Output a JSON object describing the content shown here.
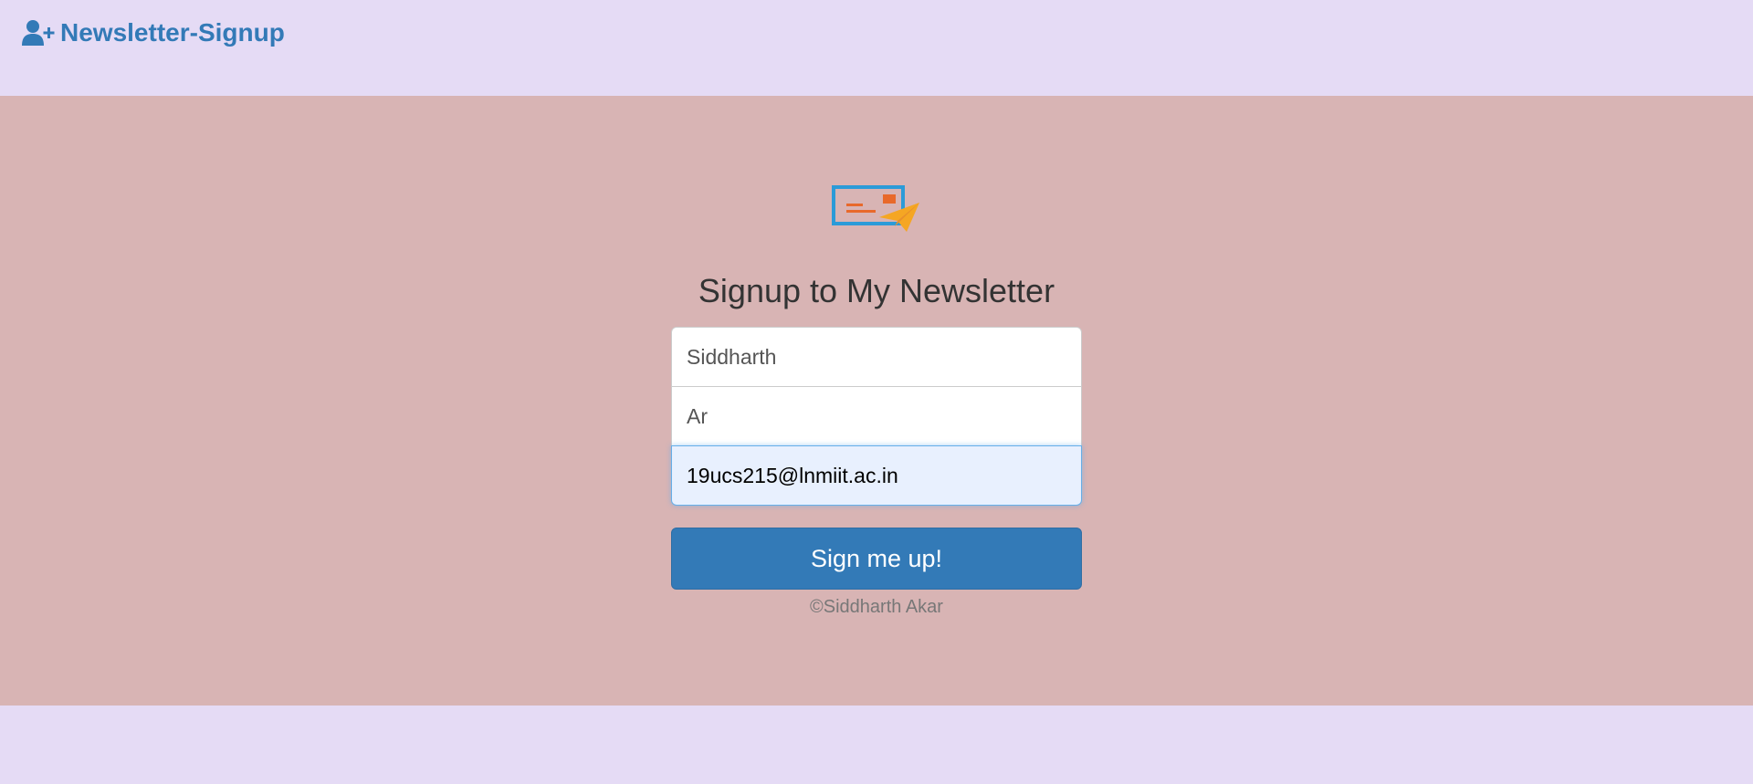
{
  "navbar": {
    "brand_label": "Newsletter-Signup",
    "brand_icon": "user-plus-icon",
    "brand_color": "#337ab7"
  },
  "hero": {
    "logo_icon": "envelope-paper-plane-icon",
    "title": "Signup to My Newsletter",
    "background": "#d8b4b4"
  },
  "form": {
    "first_name_value": "Siddharth",
    "last_name_value": "Ar",
    "email_value": "19ucs215@lnmiit.ac.in",
    "submit_label": "Sign me up!",
    "button_color": "#337ab7"
  },
  "footer": {
    "copyright": "©Siddharth Akar"
  },
  "page": {
    "background": "#e5dbf5"
  }
}
